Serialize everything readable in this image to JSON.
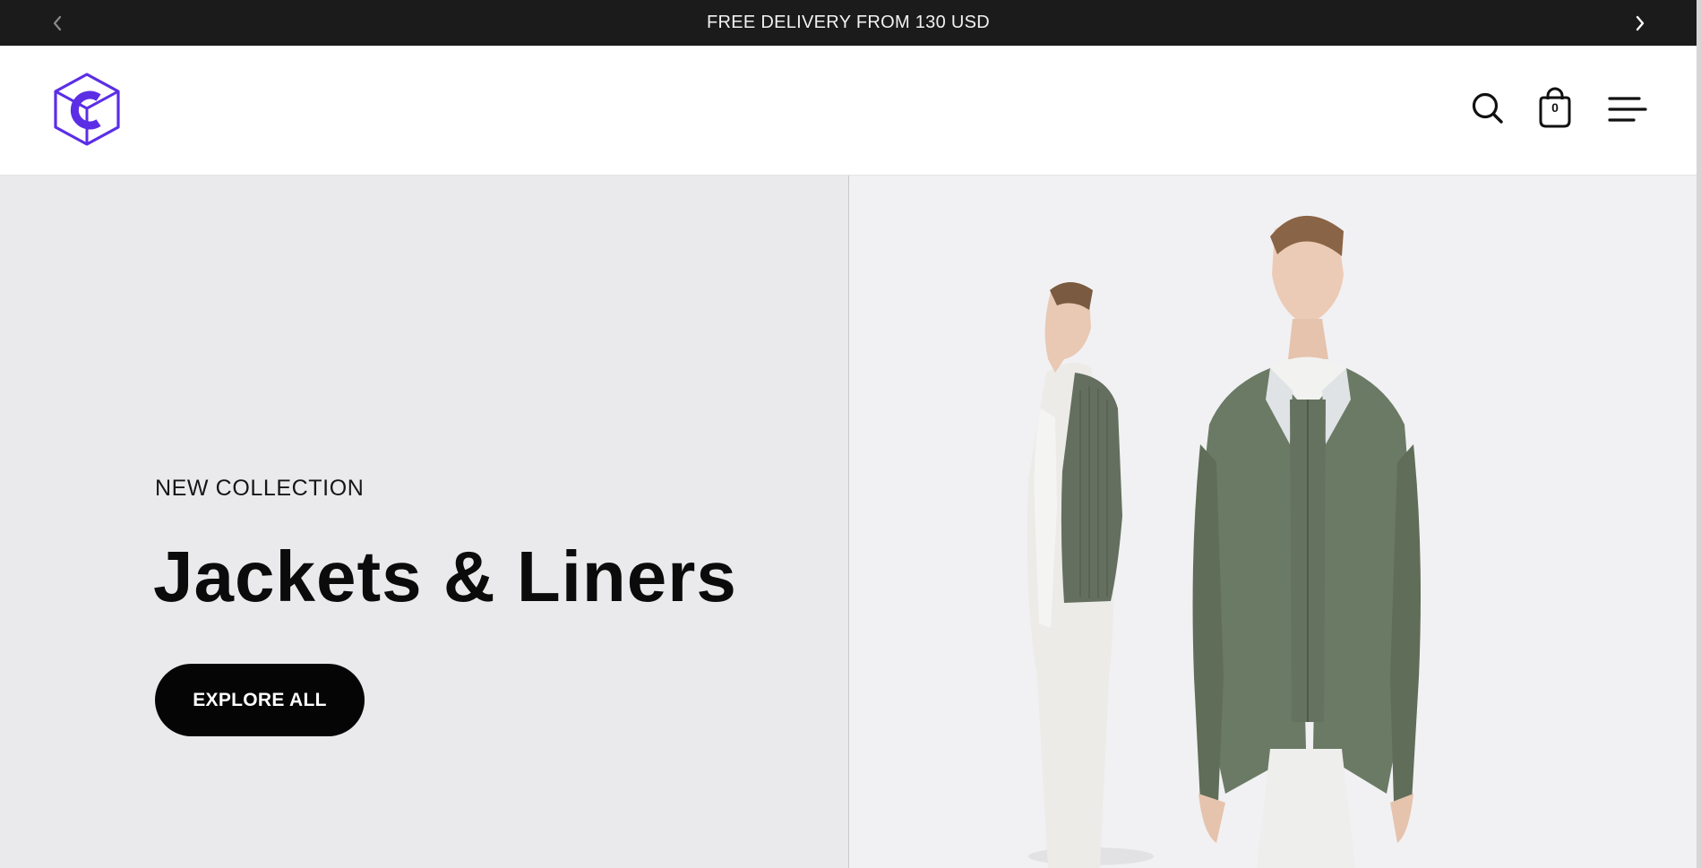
{
  "announcement": {
    "text": "FREE DELIVERY FROM 130 USD",
    "prev_icon": "chevron-left-icon",
    "next_icon": "chevron-right-icon"
  },
  "header": {
    "logo": "cube-c-logo",
    "icons": [
      "search-icon",
      "shopping-bag-icon",
      "menu-icon"
    ],
    "cart_count": "0"
  },
  "hero": {
    "eyebrow": "NEW COLLECTION",
    "title": "Jackets & Liners",
    "cta_label": "EXPLORE ALL",
    "image": "two-models-green-jacket-and-vest"
  },
  "colors": {
    "announcement_bg": "#1b1b1c",
    "brand_purple": "#5b2ee6",
    "hero_left_bg": "#eaeaec",
    "hero_right_bg": "#f1f1f3",
    "cta_bg": "#050505",
    "jacket_green": "#6b7a65"
  }
}
